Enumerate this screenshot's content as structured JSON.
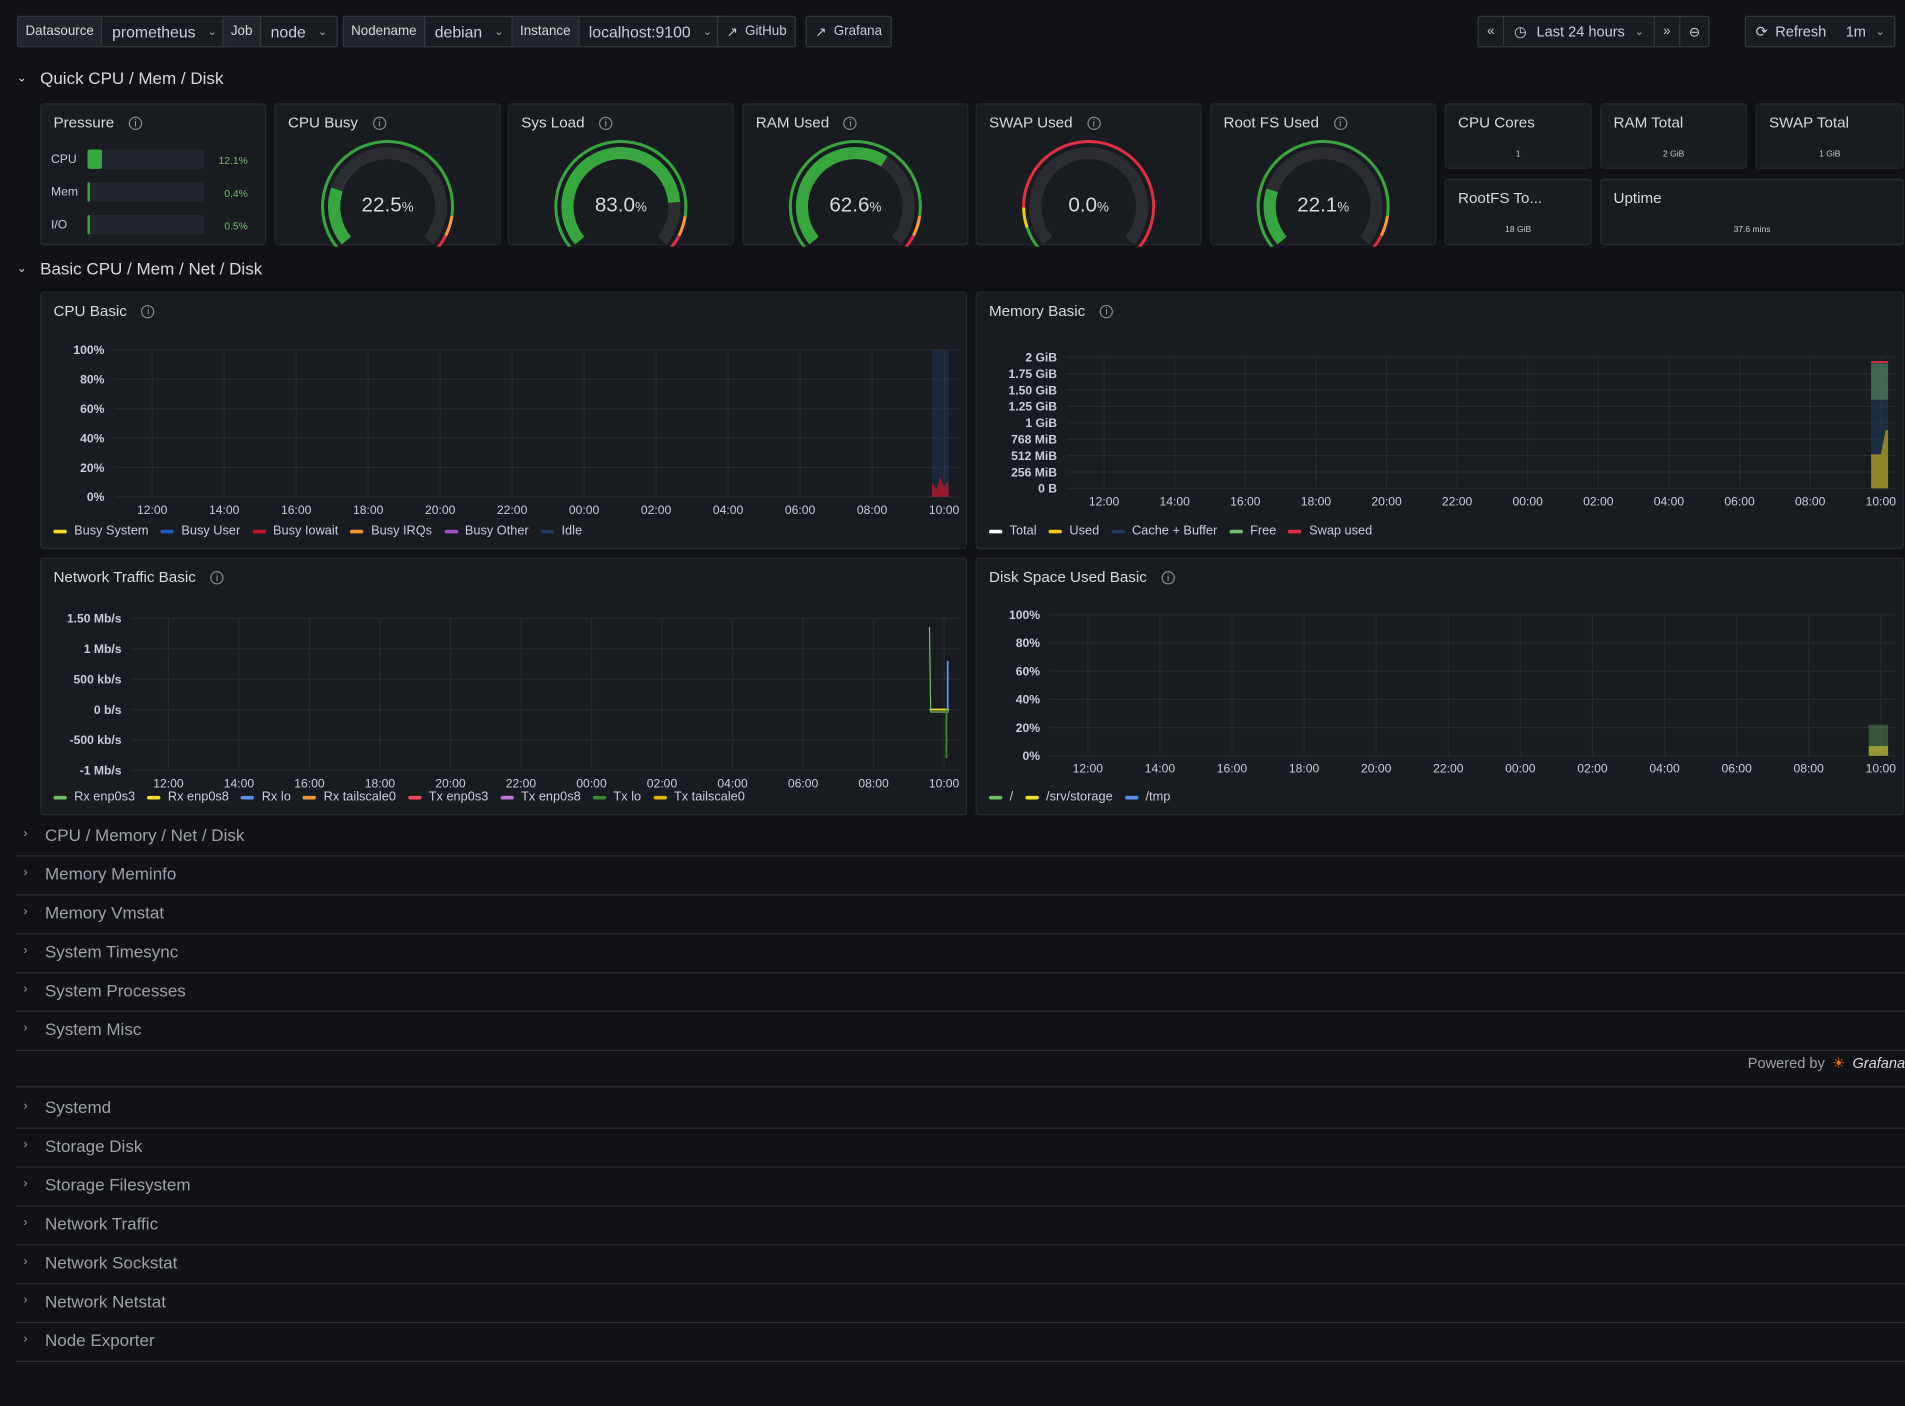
{
  "toolbar": {
    "datasource": {
      "label": "Datasource",
      "value": "prometheus"
    },
    "job": {
      "label": "Job",
      "value": "node"
    },
    "nodename": {
      "label": "Nodename",
      "value": "debian"
    },
    "instance": {
      "label": "Instance",
      "value": "localhost:9100"
    },
    "github": "GitHub",
    "grafana": "Grafana",
    "time_range": "Last 24 hours",
    "refresh": "Refresh",
    "interval": "1m"
  },
  "rows": {
    "quick": "Quick CPU / Mem / Disk",
    "basic": "Basic CPU / Mem / Net / Disk",
    "collapsed_a": [
      "CPU / Memory / Net / Disk",
      "Memory Meminfo",
      "Memory Vmstat",
      "System Timesync",
      "System Processes",
      "System Misc"
    ],
    "collapsed_b": [
      "Systemd",
      "Storage Disk",
      "Storage Filesystem",
      "Network Traffic",
      "Network Sockstat",
      "Network Netstat",
      "Node Exporter"
    ]
  },
  "powered": {
    "text": "Powered by",
    "brand": "Grafana"
  },
  "pressure": {
    "title": "Pressure",
    "rows": [
      {
        "label": "CPU",
        "value": "12.1%",
        "fraction": 0.121
      },
      {
        "label": "Mem",
        "value": "0.4%",
        "fraction": 0.004
      },
      {
        "label": "I/O",
        "value": "0.5%",
        "fraction": 0.005
      }
    ]
  },
  "gauges": [
    {
      "title": "CPU Busy",
      "value": "22.5",
      "unit": "%",
      "fraction": 0.225
    },
    {
      "title": "Sys Load",
      "value": "83.0",
      "unit": "%",
      "fraction": 0.83
    },
    {
      "title": "RAM Used",
      "value": "62.6",
      "unit": "%",
      "fraction": 0.626
    },
    {
      "title": "SWAP Used",
      "value": "0.0",
      "unit": "%",
      "fraction": 0.0
    },
    {
      "title": "Root FS Used",
      "value": "22.1",
      "unit": "%",
      "fraction": 0.221
    }
  ],
  "stats": {
    "cpu_cores": {
      "title": "CPU Cores",
      "value": "1"
    },
    "ram_total": {
      "title": "RAM Total",
      "value": "2 GiB"
    },
    "swap_total": {
      "title": "SWAP Total",
      "value": "1 GiB"
    },
    "rootfs_total": {
      "title": "RootFS To...",
      "value": "18 GiB"
    },
    "uptime": {
      "title": "Uptime",
      "value": "37.6 mins"
    }
  },
  "colors": {
    "green": "#37a63e",
    "gauge_track": "#2b2d33",
    "yellow": "#f2cc0c",
    "red": "#e02f44",
    "orange": "#ff9830"
  },
  "chart_data": [
    {
      "id": "cpu",
      "type": "area",
      "title": "CPU Basic",
      "x_ticks": [
        "12:00",
        "14:00",
        "16:00",
        "18:00",
        "20:00",
        "22:00",
        "00:00",
        "02:00",
        "04:00",
        "06:00",
        "08:00",
        "10:00"
      ],
      "y_ticks": [
        "100%",
        "80%",
        "60%",
        "40%",
        "20%",
        "0%"
      ],
      "ylim": [
        0,
        100
      ],
      "series": [
        {
          "name": "Busy System",
          "color": "#fade2a"
        },
        {
          "name": "Busy User",
          "color": "#1f60c4"
        },
        {
          "name": "Busy Iowait",
          "color": "#c4162a"
        },
        {
          "name": "Busy IRQs",
          "color": "#ff9830"
        },
        {
          "name": "Busy Other",
          "color": "#a352cc"
        },
        {
          "name": "Idle",
          "color": "#1f3a5e"
        }
      ]
    },
    {
      "id": "mem",
      "type": "area",
      "title": "Memory Basic",
      "x_ticks": [
        "12:00",
        "14:00",
        "16:00",
        "18:00",
        "20:00",
        "22:00",
        "00:00",
        "02:00",
        "04:00",
        "06:00",
        "08:00",
        "10:00"
      ],
      "y_ticks": [
        "2 GiB",
        "1.75 GiB",
        "1.50 GiB",
        "1.25 GiB",
        "1 GiB",
        "768 MiB",
        "512 MiB",
        "256 MiB",
        "0 B"
      ],
      "series": [
        {
          "name": "Total",
          "color": "#ffffff"
        },
        {
          "name": "Used",
          "color": "#f2cc0c"
        },
        {
          "name": "Cache + Buffer",
          "color": "#1f3a5e"
        },
        {
          "name": "Free",
          "color": "#73bf69"
        },
        {
          "name": "Swap used",
          "color": "#e02f44"
        }
      ]
    },
    {
      "id": "net",
      "type": "line",
      "title": "Network Traffic Basic",
      "x_ticks": [
        "12:00",
        "14:00",
        "16:00",
        "18:00",
        "20:00",
        "22:00",
        "00:00",
        "02:00",
        "04:00",
        "06:00",
        "08:00",
        "10:00"
      ],
      "y_ticks": [
        "1.50 Mb/s",
        "1 Mb/s",
        "500 kb/s",
        "0 b/s",
        "-500 kb/s",
        "-1 Mb/s"
      ],
      "series": [
        {
          "name": "Rx enp0s3",
          "color": "#73bf69"
        },
        {
          "name": "Rx enp0s8",
          "color": "#fade2a"
        },
        {
          "name": "Rx lo",
          "color": "#5794f2"
        },
        {
          "name": "Rx tailscale0",
          "color": "#ff9830"
        },
        {
          "name": "Tx enp0s3",
          "color": "#f2495c"
        },
        {
          "name": "Tx enp0s8",
          "color": "#b877d9"
        },
        {
          "name": "Tx lo",
          "color": "#37872d"
        },
        {
          "name": "Tx tailscale0",
          "color": "#e0b400"
        }
      ]
    },
    {
      "id": "disk",
      "type": "area",
      "title": "Disk Space Used Basic",
      "x_ticks": [
        "12:00",
        "14:00",
        "16:00",
        "18:00",
        "20:00",
        "22:00",
        "00:00",
        "02:00",
        "04:00",
        "06:00",
        "08:00",
        "10:00"
      ],
      "y_ticks": [
        "100%",
        "80%",
        "60%",
        "40%",
        "20%",
        "0%"
      ],
      "ylim": [
        0,
        100
      ],
      "series": [
        {
          "name": "/",
          "color": "#73bf69",
          "last": 22
        },
        {
          "name": "/srv/storage",
          "color": "#fade2a",
          "last": 0
        },
        {
          "name": "/tmp",
          "color": "#5794f2",
          "last": 0
        }
      ]
    }
  ]
}
